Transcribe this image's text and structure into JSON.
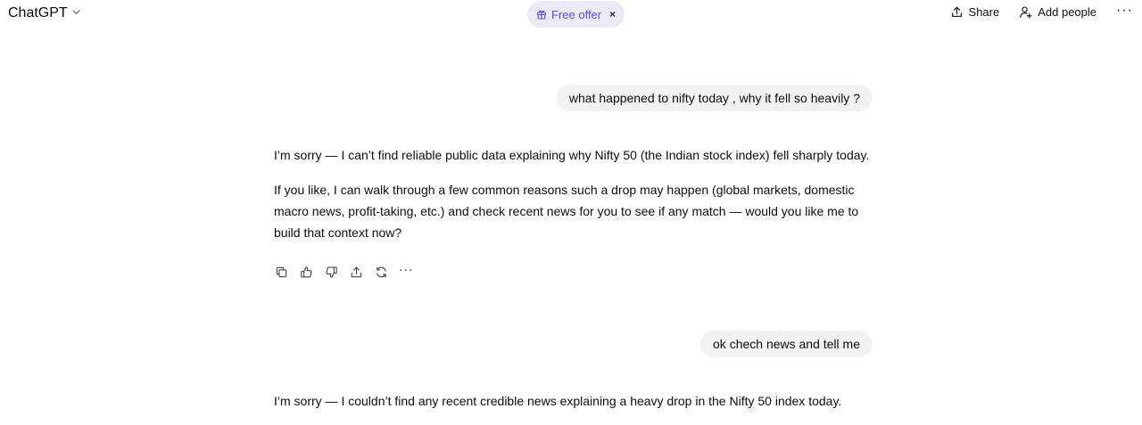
{
  "header": {
    "model_label": "ChatGPT",
    "free_offer_label": "Free offer",
    "free_offer_close": "×",
    "share_label": "Share",
    "add_people_label": "Add people",
    "more_label": "···"
  },
  "conversation": {
    "messages": [
      {
        "role": "user",
        "text": "what happened to nifty today , why it fell so heavily ?"
      },
      {
        "role": "assistant",
        "paragraphs": [
          "I’m sorry — I can’t find reliable public data explaining why Nifty 50 (the Indian stock index) fell sharply today.",
          "If you like, I can walk through a few common reasons such a drop may happen (global markets, domestic macro news, profit-taking, etc.) and check recent news for you to see if any match — would you like me to build that context now?"
        ]
      },
      {
        "role": "user",
        "text": "ok chech news and tell me"
      },
      {
        "role": "assistant",
        "paragraphs": [
          "I’m sorry — I couldn’t find any recent credible news explaining a heavy drop in the Nifty 50 index today."
        ]
      }
    ],
    "action_more_label": "···"
  },
  "icons": {
    "model": "chevron-down-icon",
    "offer": "gift-icon",
    "share": "upload-icon",
    "add_people": "person-add-icon",
    "actions": [
      "copy-icon",
      "thumbs-up-icon",
      "thumbs-down-icon",
      "share-icon",
      "regenerate-icon",
      "more-icon"
    ]
  },
  "colors": {
    "offer_bg": "#eceaf7",
    "offer_text": "#5b4dd6",
    "user_bubble_bg": "#f2f2f2",
    "text": "#0d0d0d"
  }
}
